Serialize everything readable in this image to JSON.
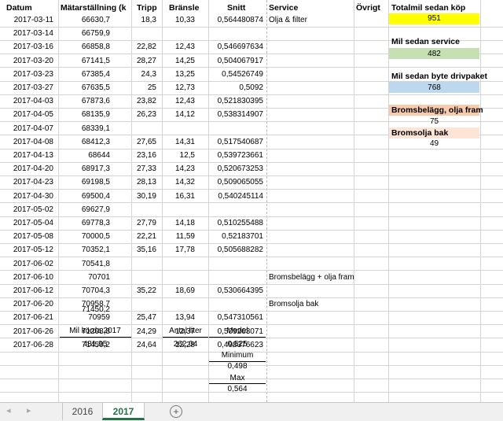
{
  "headers": {
    "datum": "Datum",
    "matar": "Mätarställning (k",
    "tripp": "Tripp",
    "bransle": "Bränsle",
    "snitt": "Snitt",
    "service": "Service",
    "ovrigt": "Övrigt",
    "totalmil": "Totalmil sedan köp"
  },
  "rows": [
    {
      "datum": "2017-03-11",
      "matar": "66630,7",
      "tripp": "18,3",
      "bransle": "10,33",
      "snitt": "0,564480874",
      "service": "Olja & filter"
    },
    {
      "datum": "2017-03-14",
      "matar": "66759,9",
      "tripp": "",
      "bransle": "",
      "snitt": "",
      "service": ""
    },
    {
      "datum": "2017-03-16",
      "matar": "66858,8",
      "tripp": "22,82",
      "bransle": "12,43",
      "snitt": "0,546697634",
      "service": ""
    },
    {
      "datum": "2017-03-20",
      "matar": "67141,5",
      "tripp": "28,27",
      "bransle": "14,25",
      "snitt": "0,504067917",
      "service": ""
    },
    {
      "datum": "2017-03-23",
      "matar": "67385,4",
      "tripp": "24,3",
      "bransle": "13,25",
      "snitt": "0,54526749",
      "service": ""
    },
    {
      "datum": "2017-03-27",
      "matar": "67635,5",
      "tripp": "25",
      "bransle": "12,73",
      "snitt": "0,5092",
      "service": ""
    },
    {
      "datum": "2017-04-03",
      "matar": "67873,6",
      "tripp": "23,82",
      "bransle": "12,43",
      "snitt": "0,521830395",
      "service": ""
    },
    {
      "datum": "2017-04-05",
      "matar": "68135,9",
      "tripp": "26,23",
      "bransle": "14,12",
      "snitt": "0,538314907",
      "service": ""
    },
    {
      "datum": "2017-04-07",
      "matar": "68339,1",
      "tripp": "",
      "bransle": "",
      "snitt": "",
      "service": ""
    },
    {
      "datum": "2017-04-08",
      "matar": "68412,3",
      "tripp": "27,65",
      "bransle": "14,31",
      "snitt": "0,517540687",
      "service": ""
    },
    {
      "datum": "2017-04-13",
      "matar": "68644",
      "tripp": "23,16",
      "bransle": "12,5",
      "snitt": "0,539723661",
      "service": ""
    },
    {
      "datum": "2017-04-20",
      "matar": "68917,3",
      "tripp": "27,33",
      "bransle": "14,23",
      "snitt": "0,520673253",
      "service": ""
    },
    {
      "datum": "2017-04-23",
      "matar": "69198,5",
      "tripp": "28,13",
      "bransle": "14,32",
      "snitt": "0,509065055",
      "service": ""
    },
    {
      "datum": "2017-04-30",
      "matar": "69500,4",
      "tripp": "30,19",
      "bransle": "16,31",
      "snitt": "0,540245114",
      "service": ""
    },
    {
      "datum": "2017-05-02",
      "matar": "69627,9",
      "tripp": "",
      "bransle": "",
      "snitt": "",
      "service": ""
    },
    {
      "datum": "2017-05-04",
      "matar": "69778,3",
      "tripp": "27,79",
      "bransle": "14,18",
      "snitt": "0,510255488",
      "service": ""
    },
    {
      "datum": "2017-05-08",
      "matar": "70000,5",
      "tripp": "22,21",
      "bransle": "11,59",
      "snitt": "0,52183701",
      "service": ""
    },
    {
      "datum": "2017-05-12",
      "matar": "70352,1",
      "tripp": "35,16",
      "bransle": "17,78",
      "snitt": "0,505688282",
      "service": ""
    },
    {
      "datum": "2017-06-02",
      "matar": "70541,8",
      "tripp": "",
      "bransle": "",
      "snitt": "",
      "service": ""
    },
    {
      "datum": "2017-06-10",
      "matar": "70701",
      "tripp": "",
      "bransle": "",
      "snitt": "",
      "service": "Bromsbelägg + olja fram"
    },
    {
      "datum": "2017-06-12",
      "matar": "70704,3",
      "tripp": "35,22",
      "bransle": "18,69",
      "snitt": "0,530664395",
      "service": ""
    },
    {
      "datum": "2017-06-20",
      "matar": "70958,7",
      "tripp": "",
      "bransle": "",
      "snitt": "",
      "service": "Bromsolja bak"
    },
    {
      "datum": "2017-06-21",
      "matar": "70959",
      "tripp": "25,47",
      "bransle": "13,94",
      "snitt": "0,547310561",
      "service": ""
    },
    {
      "datum": "2017-06-26",
      "matar": "71203,8",
      "tripp": "24,29",
      "bransle": "12,37",
      "snitt": "0,509263071",
      "service": ""
    },
    {
      "datum": "2017-06-28",
      "matar": "71450,2",
      "tripp": "24,64",
      "bransle": "12,28",
      "snitt": "0,498376623",
      "service": ""
    }
  ],
  "extra_matar": "71450,2",
  "summary": {
    "mil_label": "Mil körda 2017",
    "mil_value": "481,95",
    "liter_label": "Antal liter",
    "liter_value": "262,04",
    "medel_label": "Medel",
    "medel_value": "0,525",
    "min_label": "Minimum",
    "min_value": "0,498",
    "max_label": "Max",
    "max_value": "0,564"
  },
  "side": {
    "totalmil_value": "951",
    "mil_service_label": "Mil sedan service",
    "mil_service_value": "482",
    "mil_drivpaket_label": "Mil sedan byte drivpaket",
    "mil_drivpaket_value": "768",
    "broms_fram_label": "Bromsbelägg, olja fram",
    "broms_fram_value": "75",
    "broms_bak_label": "Bromsolja bak",
    "broms_bak_value": "49"
  },
  "colors": {
    "yellow": "#ffff00",
    "green": "#c6e0b4",
    "blue": "#bdd7ee",
    "peach": "#f8cbad",
    "light_peach": "#fce4d6",
    "excel_green": "#217346"
  },
  "tabs": [
    {
      "label": "2016",
      "active": false
    },
    {
      "label": "2017",
      "active": true
    }
  ],
  "icons": {
    "nav_prev": "◂",
    "nav_next": "▸",
    "add_sheet": "+"
  }
}
